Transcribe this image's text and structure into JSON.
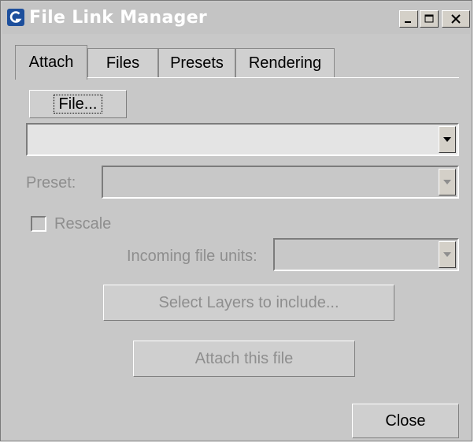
{
  "window": {
    "title": "File Link Manager"
  },
  "title_buttons": {
    "minimize": "minimize-icon",
    "maximize": "maximize-icon",
    "close": "close-icon"
  },
  "tabs": [
    {
      "label": "Attach",
      "active": true
    },
    {
      "label": "Files",
      "active": false
    },
    {
      "label": "Presets",
      "active": false
    },
    {
      "label": "Rendering",
      "active": false
    }
  ],
  "attach": {
    "file_button": "File...",
    "file_combo_value": "",
    "preset_label": "Preset:",
    "preset_value": "",
    "rescale_label": "Rescale",
    "rescale_checked": false,
    "incoming_units_label": "Incoming file units:",
    "incoming_units_value": "",
    "select_layers_button": "Select Layers to include...",
    "attach_button": "Attach this file",
    "close_button": "Close"
  },
  "colors": {
    "title_text": "#ffffff",
    "disabled_text": "#8e8e8e",
    "panel_bg": "#c8c8c8"
  }
}
